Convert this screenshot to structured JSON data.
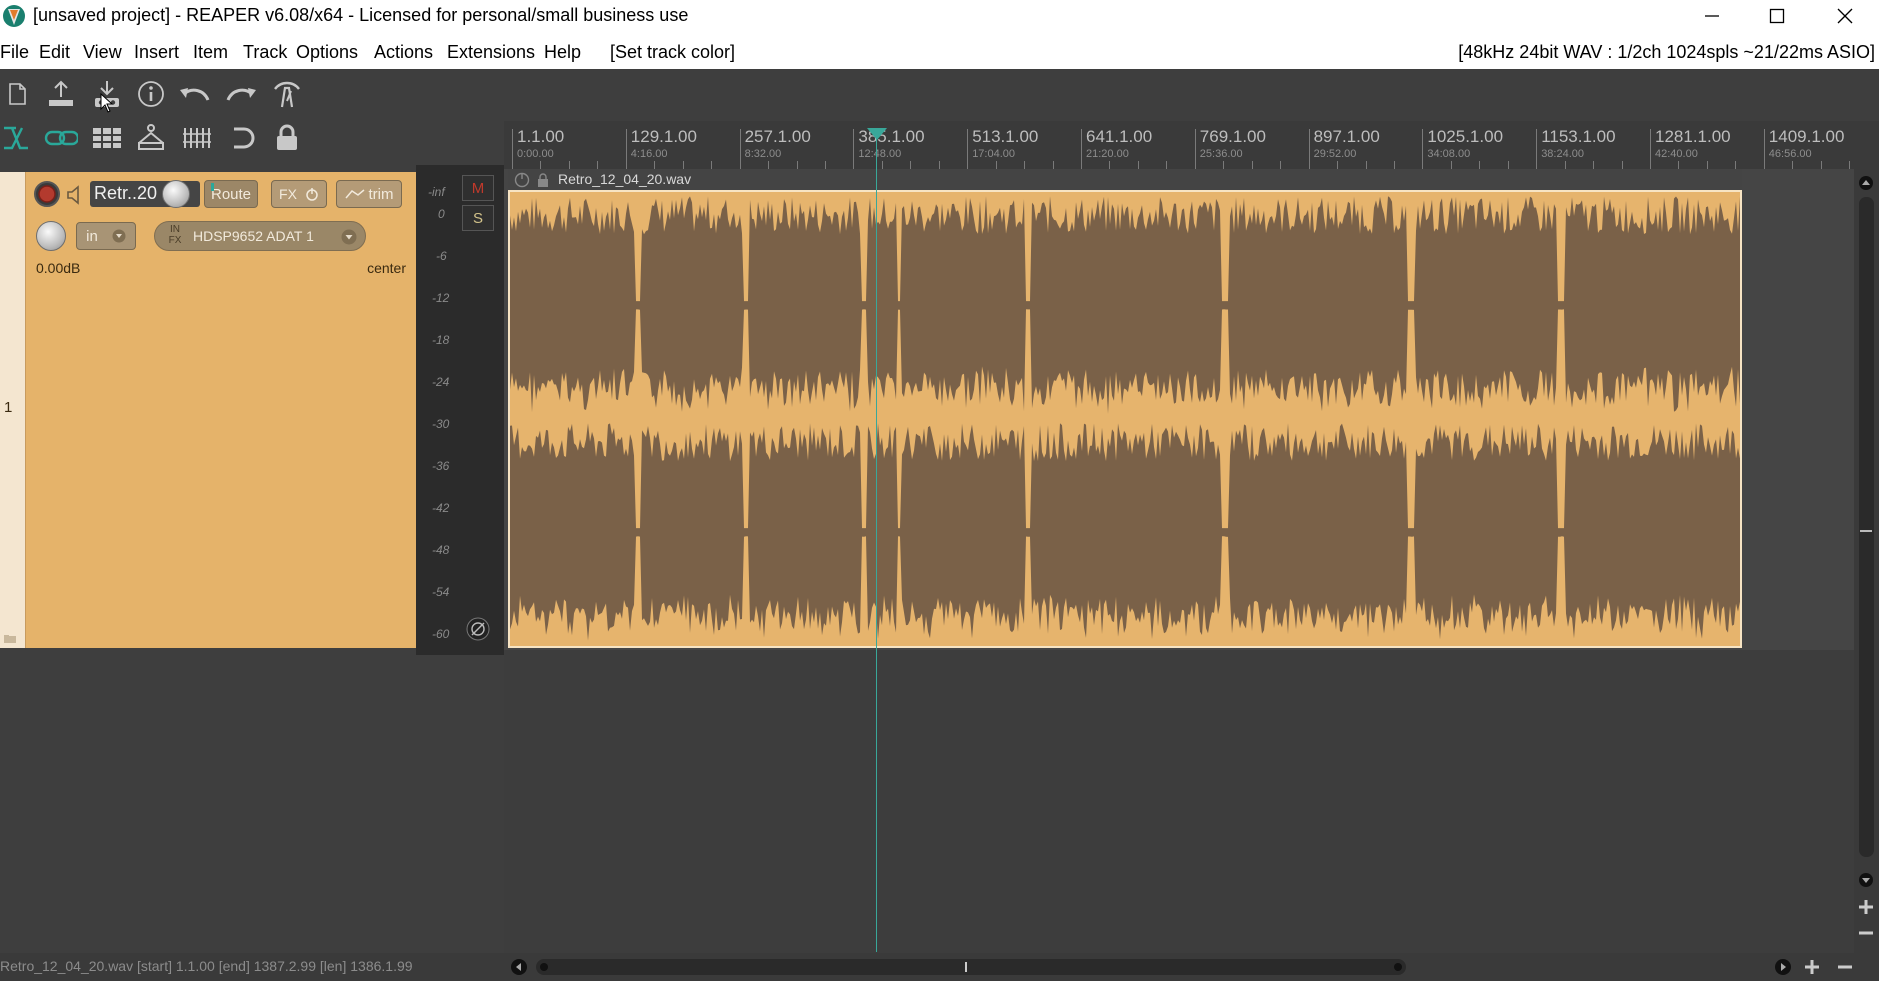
{
  "window": {
    "title": "[unsaved project] - REAPER v6.08/x64 - Licensed for personal/small business use"
  },
  "menu": {
    "items": [
      "File",
      "Edit",
      "View",
      "Insert",
      "Item",
      "Track",
      "Options",
      "Actions",
      "Extensions",
      "Help",
      "[Set track color]"
    ],
    "audio_info": "[48kHz 24bit WAV : 1/2ch 1024spls ~21/22ms ASIO]"
  },
  "toolbar": {
    "row1_icons": [
      "new-project-icon",
      "open-project-icon",
      "save-project-icon",
      "project-settings-icon",
      "undo-icon",
      "redo-icon",
      "metronome-icon"
    ],
    "row2_icons": [
      "snap-icon",
      "ripple-edit-icon",
      "grid-icon",
      "envelope-icon",
      "auto-crossfade-icon",
      "loop-icon",
      "lock-icon"
    ]
  },
  "track": {
    "number": "1",
    "name": "Retr..20",
    "route_label": "Route",
    "fx_label": "FX",
    "trim_label": "trim",
    "input_mode": "in",
    "input_fx_label": "IN FX",
    "input_device": "HDSP9652 ADAT 1",
    "volume": "0.00dB",
    "pan": "center",
    "mute_label": "M",
    "solo_label": "S",
    "meter_scale": [
      "-inf",
      "0",
      "-6",
      "-12",
      "-18",
      "-24",
      "-30",
      "-36",
      "-42",
      "-48",
      "-54",
      "-60"
    ]
  },
  "ruler": {
    "marks": [
      {
        "bar": "1.1.00",
        "time": "0:00.00"
      },
      {
        "bar": "129.1.00",
        "time": "4:16.00"
      },
      {
        "bar": "257.1.00",
        "time": "8:32.00"
      },
      {
        "bar": "385.1.00",
        "time": "12:48.00"
      },
      {
        "bar": "513.1.00",
        "time": "17:04.00"
      },
      {
        "bar": "641.1.00",
        "time": "21:20.00"
      },
      {
        "bar": "769.1.00",
        "time": "25:36.00"
      },
      {
        "bar": "897.1.00",
        "time": "29:52.00"
      },
      {
        "bar": "1025.1.00",
        "time": "34:08.00"
      },
      {
        "bar": "1153.1.00",
        "time": "38:24.00"
      },
      {
        "bar": "1281.1.00",
        "time": "42:40.00"
      },
      {
        "bar": "1409.1.00",
        "time": "46:56.00"
      }
    ]
  },
  "item": {
    "name": "Retro_12_04_20.wav"
  },
  "status": {
    "text": "Retro_12_04_20.wav [start] 1.1.00 [end] 1387.2.99 [len] 1386.1.99"
  },
  "colors": {
    "track": "#e5b36a",
    "waveform": "#7a6148",
    "cursor": "#39a89a",
    "background": "#3e3e3e"
  }
}
